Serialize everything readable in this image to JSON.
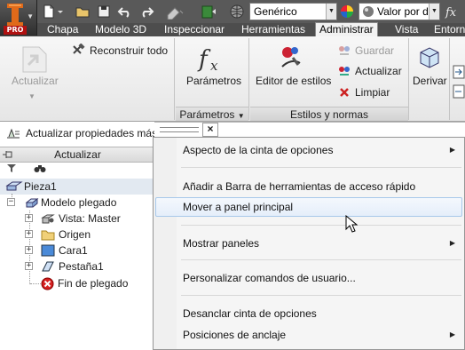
{
  "quick_access": {
    "app_badge": "PRO",
    "material_combo": "Genérico",
    "appearance_combo": "Valor por d"
  },
  "tabs": [
    "Chapa",
    "Modelo 3D",
    "Inspeccionar",
    "Herramientas",
    "Administrar",
    "Vista",
    "Entorn"
  ],
  "active_tab": "Administrar",
  "ribbon": {
    "update_label": "Actualizar",
    "rebuild_all_label": "Reconstruir todo",
    "parameters_label": "Parámetros",
    "parameters_panel_title": "Parámetros",
    "style_editor_label": "Editor de estilos",
    "save_label": "Guardar",
    "update_styles_label": "Actualizar",
    "clean_label": "Limpiar",
    "styles_panel_title": "Estilos y normas",
    "derive_label": "Derivar"
  },
  "browser": {
    "update_mass_props": "Actualizar propiedades másicas",
    "panel_title": "Actualizar",
    "tree": [
      {
        "label": "Pieza1"
      },
      {
        "label": "Modelo plegado"
      },
      {
        "label": "Vista: Master"
      },
      {
        "label": "Origen"
      },
      {
        "label": "Cara1"
      },
      {
        "label": "Pestaña1"
      },
      {
        "label": "Fin de plegado"
      }
    ]
  },
  "context_menu": {
    "items": [
      {
        "label": "Aspecto de la cinta de opciones",
        "submenu": true
      },
      {
        "label": "Añadir a Barra de herramientas de acceso rápido",
        "submenu": false
      },
      {
        "label": "Mover a panel principal",
        "submenu": false,
        "hover": true
      },
      {
        "label": "Mostrar paneles",
        "submenu": true
      },
      {
        "label": "Personalizar comandos de usuario...",
        "submenu": false
      },
      {
        "label": "Desanclar cinta de opciones",
        "submenu": false
      },
      {
        "label": "Posiciones de anclaje",
        "submenu": true
      }
    ]
  },
  "colors": {
    "title_bar": "#595959",
    "tab_bar": "#4d4d4d",
    "menu_hover": "#e5eefa",
    "app_red": "#b01010",
    "logo_orange": "#e06a1a"
  }
}
